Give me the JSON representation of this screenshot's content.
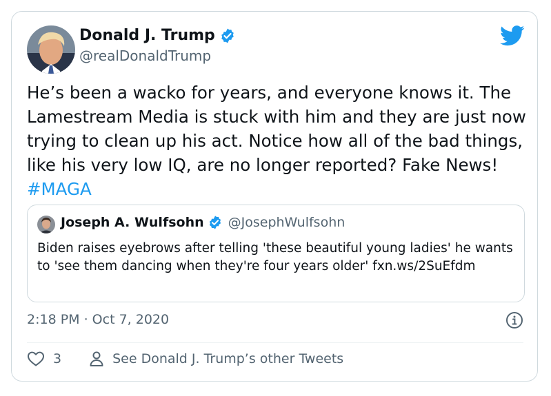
{
  "tweet": {
    "author_name": "Donald J. Trump",
    "author_handle": "@realDonaldTrump",
    "text": "He’s been a wacko for years, and everyone knows it. The Lamestream Media is stuck with him and they are just now trying to clean up his act. Notice how all of the bad things, like his very low IQ, are no longer reported? Fake News! ",
    "hashtag": "#MAGA",
    "timestamp": "2:18 PM · Oct 7, 2020",
    "like_count": "3",
    "other_tweets_label": "See Donald J. Trump’s other Tweets"
  },
  "quoted_tweet": {
    "author_name": "Joseph A. Wulfsohn",
    "author_handle": "@JosephWulfsohn",
    "text": "Biden raises eyebrows after telling 'these beautiful young ladies' he wants to 'see them dancing when they're four years older' fxn.ws/2SuEfdm"
  },
  "icons": {
    "verified": "verified-badge-icon",
    "twitter": "twitter-bird-icon",
    "info": "info-icon",
    "like": "heart-icon",
    "profile": "person-icon"
  },
  "colors": {
    "accent": "#1d9bf0",
    "secondary_text": "#536471",
    "border": "#cfd9de"
  }
}
